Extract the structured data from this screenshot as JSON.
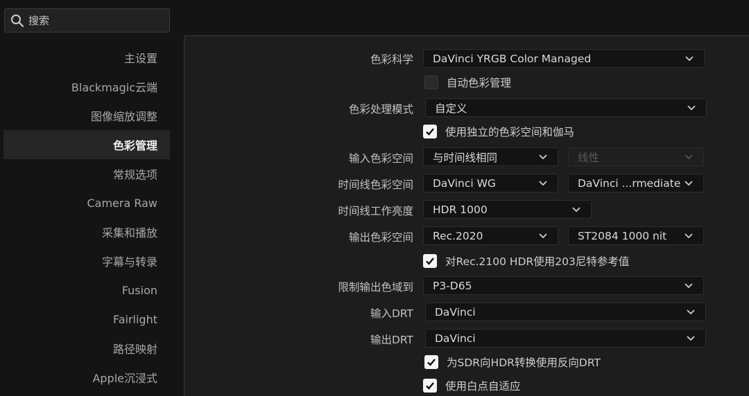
{
  "search": {
    "label": "搜索"
  },
  "sidebar": {
    "items": [
      {
        "label": "主设置"
      },
      {
        "label": "Blackmagic云端"
      },
      {
        "label": "图像缩放调整"
      },
      {
        "label": "色彩管理"
      },
      {
        "label": "常规选项"
      },
      {
        "label": "Camera Raw"
      },
      {
        "label": "采集和播放"
      },
      {
        "label": "字幕与转录"
      },
      {
        "label": "Fusion"
      },
      {
        "label": "Fairlight"
      },
      {
        "label": "路径映射"
      },
      {
        "label": "Apple沉浸式"
      }
    ],
    "active": "色彩管理"
  },
  "color": {
    "science_label": "色彩科学",
    "science_value": "DaVinci YRGB Color Managed",
    "auto_cm_label": "自动色彩管理",
    "auto_cm_checked": false,
    "processing_mode_label": "色彩处理模式",
    "processing_mode_value": "自定义",
    "separate_gamma_label": "使用独立的色彩空间和伽马",
    "separate_gamma_checked": true,
    "input_space_label": "输入色彩空间",
    "input_space_value": "与时间线相同",
    "input_gamma_value": "线性",
    "timeline_space_label": "时间线色彩空间",
    "timeline_space_value": "DaVinci WG",
    "timeline_gamma_value": "DaVinci ...rmediate",
    "timeline_luminance_label": "时间线工作亮度",
    "timeline_luminance_value": "HDR 1000",
    "output_space_label": "输出色彩空间",
    "output_space_value": "Rec.2020",
    "output_gamma_value": "ST2084 1000 nit",
    "rec2100_label": "对Rec.2100 HDR使用203尼特参考值",
    "rec2100_checked": true,
    "limit_gamut_label": "限制输出色域到",
    "limit_gamut_value": "P3-D65",
    "input_drt_label": "输入DRT",
    "input_drt_value": "DaVinci",
    "output_drt_label": "输出DRT",
    "output_drt_value": "DaVinci",
    "inverse_drt_label": "为SDR向HDR转换使用反向DRT",
    "inverse_drt_checked": true,
    "white_point_label": "使用白点自适应",
    "white_point_checked": true
  },
  "icons": {
    "search": "search-icon",
    "chevron": "chevron-down-icon",
    "check": "checkmark-icon"
  }
}
